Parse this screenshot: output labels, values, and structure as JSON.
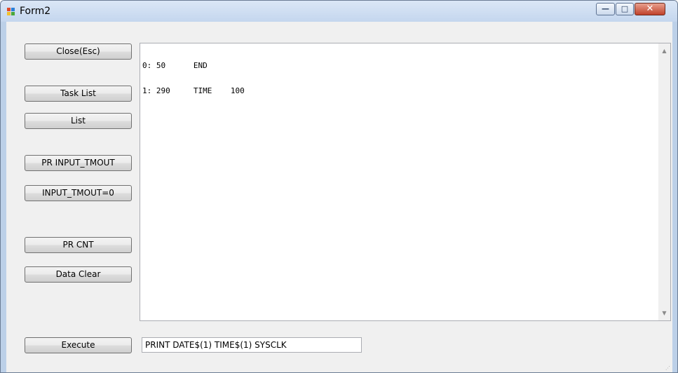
{
  "window": {
    "title": "Form2",
    "minimize_label": "—",
    "maximize_label": "□",
    "close_label": "✕"
  },
  "buttons": {
    "close": "Close(Esc)",
    "task_list": "Task List",
    "list": "List",
    "pr_input_tmout": "PR INPUT_TMOUT",
    "input_tmout_zero": "INPUT_TMOUT=0",
    "pr_cnt": "PR CNT",
    "data_clear": "Data Clear",
    "execute": "Execute"
  },
  "output": {
    "lines": [
      "0: 50      END",
      "1: 290     TIME    100"
    ]
  },
  "command": {
    "value": "PRINT DATE$(1) TIME$(1) SYSCLK"
  },
  "icons": {
    "app": "form-icon",
    "scroll_up": "arrow-up-icon",
    "scroll_down": "arrow-down-icon",
    "resize_grip": "resize-grip-icon"
  }
}
